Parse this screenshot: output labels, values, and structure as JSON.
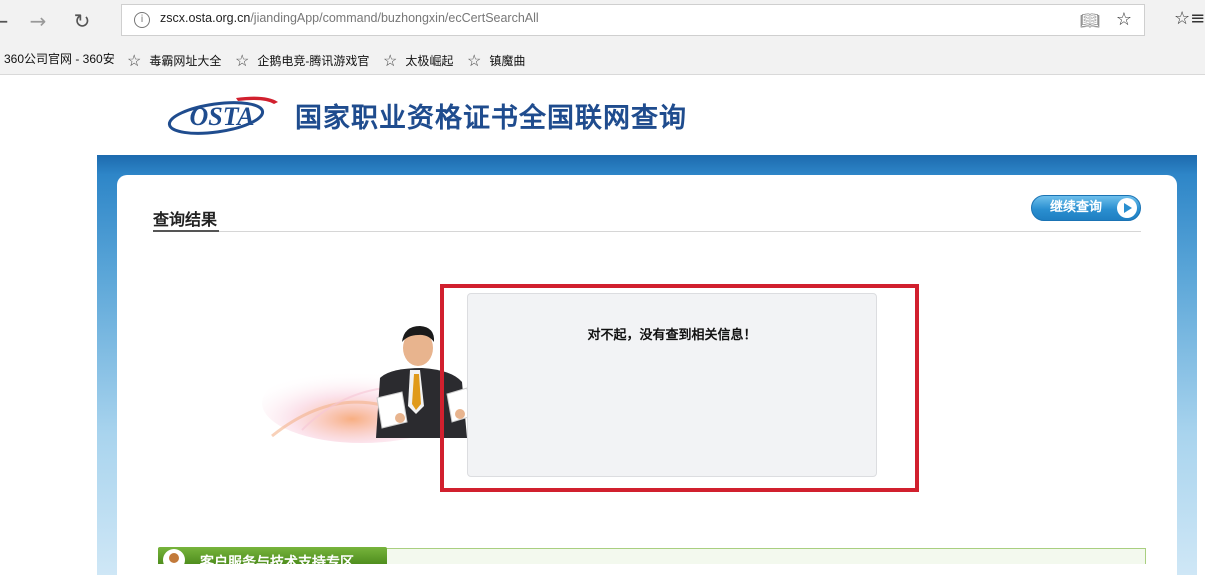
{
  "browser": {
    "url_host": "zscx.osta.org.cn",
    "url_path": "/jiandingApp/command/buzhongxin/ecCertSearchAll",
    "icons": {
      "back": "back-arrow-icon",
      "forward": "forward-arrow-icon",
      "refresh": "refresh-icon",
      "info": "info-icon",
      "reading": "reading-view-icon",
      "favorite": "star-icon",
      "favorites_hub": "favorites-icon"
    }
  },
  "bookmarks": [
    {
      "label": "360公司官网 - 360安"
    },
    {
      "label": "毒霸网址大全"
    },
    {
      "label": "企鹅电竞-腾讯游戏官"
    },
    {
      "label": "太极崛起"
    },
    {
      "label": "镇魔曲"
    }
  ],
  "header": {
    "logo_text": "OSTA",
    "title": "国家职业资格证书全国联网查询"
  },
  "main": {
    "section_title": "查询结果",
    "continue_button": "继续查询",
    "message": "对不起，没有查到相关信息！"
  },
  "support": {
    "label": "客户服务与技术支持专区"
  },
  "colors": {
    "brand_blue": "#1f4c8e",
    "frame_blue": "#1d6aae",
    "highlight_red": "#d1202e",
    "support_green": "#5e9f29"
  }
}
